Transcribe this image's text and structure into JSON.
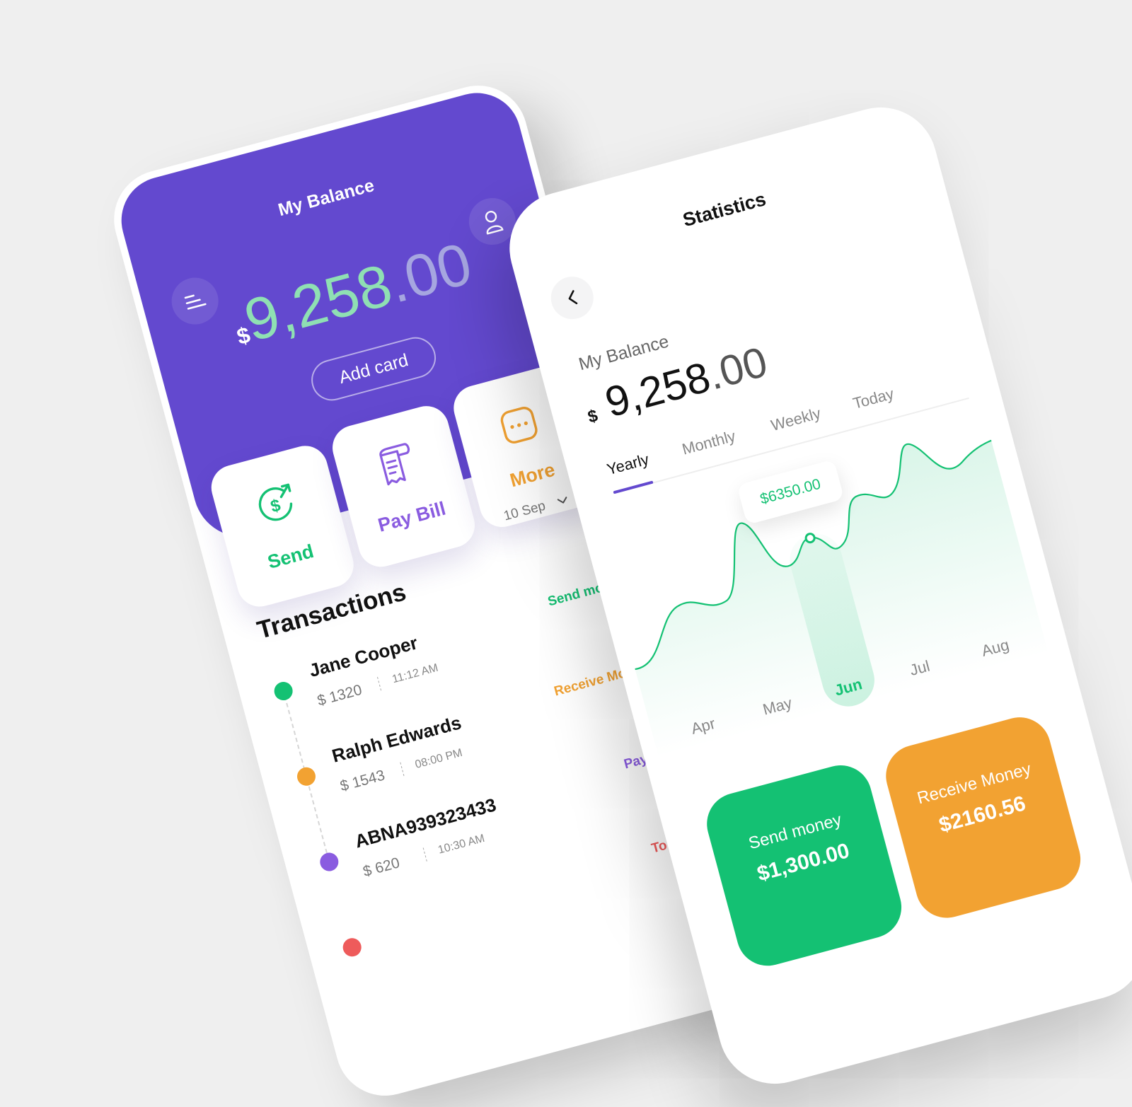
{
  "colors": {
    "primary": "#6349cf",
    "green": "#14c173",
    "orange": "#f2a232",
    "purple": "#8a5ce0",
    "mint": "#8fe0b3",
    "red": "#ee5b5b"
  },
  "home": {
    "title": "My Balance",
    "menu_icon": "menu-icon",
    "profile_icon": "user-icon",
    "balance_currency": "$",
    "balance_int": "9,258",
    "balance_dec": ".00",
    "add_card": "Add card",
    "actions": [
      {
        "label": "Send",
        "icon": "dollar-send-icon",
        "color": "#14c173"
      },
      {
        "label": "Pay Bill",
        "icon": "receipt-icon",
        "color": "#8a5ce0"
      },
      {
        "label": "More",
        "icon": "more-dots-icon",
        "color": "#f2a232"
      }
    ],
    "date_filter": "10 Sep",
    "transactions_title": "Transactions",
    "transactions": [
      {
        "name": "Jane Cooper",
        "amount": "$ 1320",
        "time": "11:12 AM",
        "type": "Send money",
        "color": "#14c173"
      },
      {
        "name": "Ralph Edwards",
        "amount": "$ 1543",
        "time": "08:00 PM",
        "type": "Receive Money",
        "color": "#f2a232"
      },
      {
        "name": "ABNA939323433",
        "amount": "$ 620",
        "time": "10:30 AM",
        "type": "Pay Bill",
        "color": "#8a5ce0"
      },
      {
        "name": "",
        "amount": "",
        "time": "",
        "type": "Top up",
        "color": "#ee5b5b"
      }
    ]
  },
  "stats": {
    "title": "Statistics",
    "back_icon": "chevron-left-icon",
    "balance_label": "My Balance",
    "balance_currency": "$",
    "balance_int": "9,258",
    "balance_dec": ".00",
    "tabs": [
      "Yearly",
      "Monthly",
      "Weekly",
      "Today"
    ],
    "active_tab": "Yearly",
    "tooltip_value": "$6350.00",
    "months": [
      "Apr",
      "May",
      "Jun",
      "Jul",
      "Aug"
    ],
    "active_month": "Jun",
    "cards": [
      {
        "title": "Send money",
        "value": "$1,300.00",
        "color": "#14c173"
      },
      {
        "title": "Receive Money",
        "value": "$2160.56",
        "color": "#f2a232"
      }
    ]
  }
}
